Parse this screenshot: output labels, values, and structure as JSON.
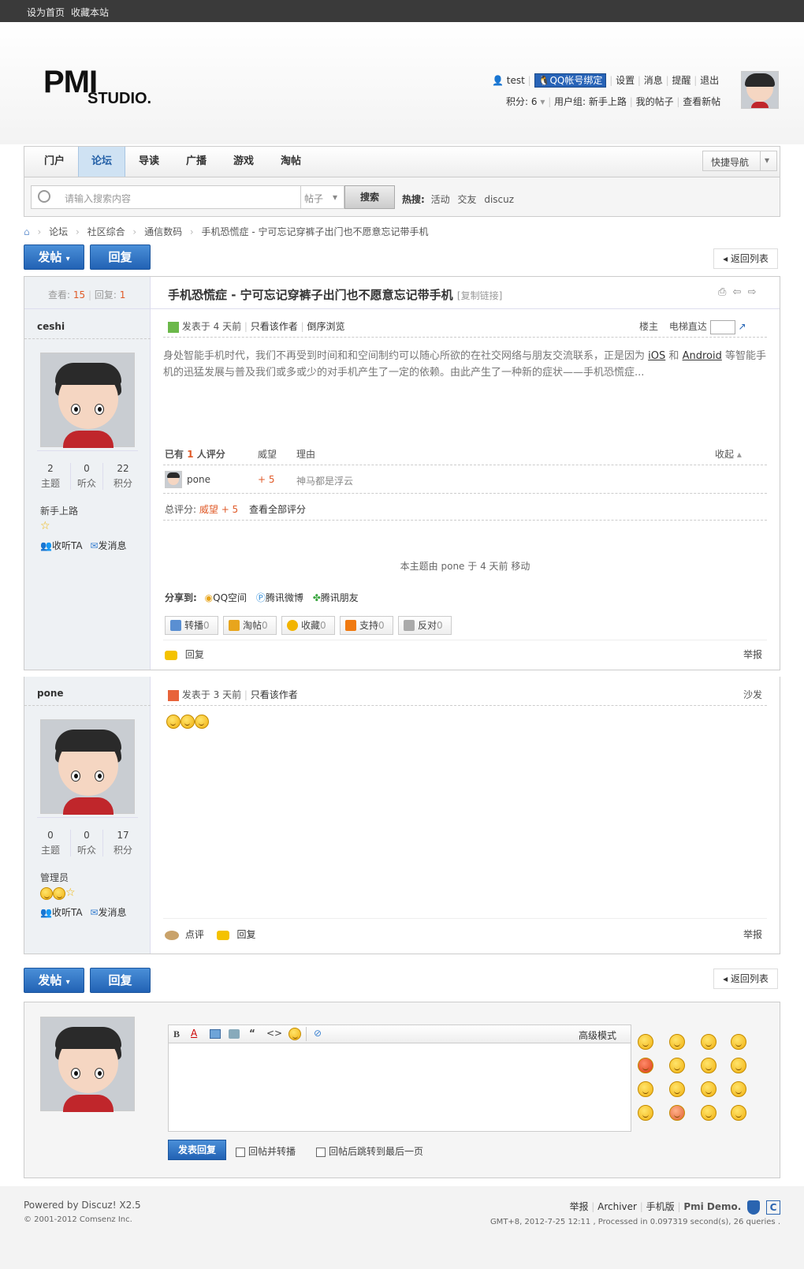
{
  "topbar": {
    "set_home": "设为首页",
    "bookmark": "收藏本站"
  },
  "logo": {
    "line1": "PMI",
    "line2": "STUDIO."
  },
  "user": {
    "name": "test",
    "qq_bind": "QQ帐号绑定",
    "settings": "设置",
    "messages": "消息",
    "reminders": "提醒",
    "logout": "退出",
    "points": "积分: 6",
    "usergroup": "用户组: 新手上路",
    "my_posts": "我的帖子",
    "new_posts": "查看新帖"
  },
  "nav": {
    "items": [
      "门户",
      "论坛",
      "导读",
      "广播",
      "游戏",
      "淘帖"
    ],
    "quick_nav": "快捷导航"
  },
  "search": {
    "placeholder": "请输入搜索内容",
    "type": "帖子",
    "button": "搜索",
    "hot_label": "热搜:",
    "hot": [
      "活动",
      "交友",
      "discuz"
    ]
  },
  "breadcrumb": [
    "论坛",
    "社区综合",
    "通信数码",
    "手机恐慌症 - 宁可忘记穿裤子出门也不愿意忘记带手机"
  ],
  "actions": {
    "new_post": "发帖",
    "reply": "回复",
    "back_to_list": "返回列表"
  },
  "thread": {
    "views_label": "查看:",
    "views": "15",
    "replies_label": "回复:",
    "replies": "1",
    "title": "手机恐慌症 - 宁可忘记穿裤子出门也不愿意忘记带手机",
    "copy_link": "[复制链接]"
  },
  "post1": {
    "author": "ceshi",
    "stats": [
      {
        "n": "2",
        "t": "主题"
      },
      {
        "n": "0",
        "t": "听众"
      },
      {
        "n": "22",
        "t": "积分"
      }
    ],
    "group": "新手上路",
    "follow": "收听TA",
    "send_msg": "发消息",
    "posted": "发表于 4 天前",
    "only_author": "只看该作者",
    "reverse": "倒序浏览",
    "floor": "楼主",
    "jump_label": "电梯直达",
    "content_1": "身处智能手机时代，我们不再受到时间和和空间制约可以随心所欲的在社交网络与朋友交流联系，正是因为",
    "link_ios": "iOS",
    "and": "和",
    "link_android": "Android",
    "content_2": "等智能手机的迅猛发展与普及我们或多或少的对手机产生了一定的依赖。由此产生了一种新的症状——手机恐慌症...",
    "rate_header": "已有",
    "rate_count": "1",
    "rate_header2": "人评分",
    "rate_col1": "威望",
    "rate_col2": "理由",
    "collapse": "收起",
    "rate_user": "pone",
    "rate_value": "+ 5",
    "rate_reason": "神马都是浮云",
    "total_label": "总评分:",
    "total_value": "威望 + 5",
    "view_all": "查看全部评分",
    "moved_notice": "本主题由 pone 于 4 天前 移动",
    "share_label": "分享到:",
    "share": [
      "QQ空间",
      "腾讯微博",
      "腾讯朋友"
    ],
    "buttons": [
      "转播",
      "淘帖",
      "收藏",
      "支持",
      "反对"
    ],
    "button_counts": [
      "0",
      "0",
      "0",
      "0",
      "0"
    ],
    "reply": "回复",
    "report": "举报"
  },
  "post2": {
    "author": "pone",
    "stats": [
      {
        "n": "0",
        "t": "主题"
      },
      {
        "n": "0",
        "t": "听众"
      },
      {
        "n": "17",
        "t": "积分"
      }
    ],
    "group": "管理员",
    "follow": "收听TA",
    "send_msg": "发消息",
    "posted": "发表于 3 天前",
    "only_author": "只看该作者",
    "floor": "沙发",
    "comment": "点评",
    "reply": "回复",
    "report": "举报"
  },
  "editor": {
    "advanced": "高级模式",
    "submit": "发表回复",
    "opt1": "回帖并转播",
    "opt2": "回帖后跳转到最后一页"
  },
  "footer": {
    "powered": "Powered by",
    "discuz": "Discuz!",
    "version": "X2.5",
    "copyright": "© 2001-2012 Comsenz Inc.",
    "links": [
      "举报",
      "Archiver",
      "手机版"
    ],
    "site": "Pmi Demo.",
    "gmt": "GMT+8, 2012-7-25 12:11 , Processed in 0.097319 second(s), 26 queries ."
  },
  "colors": {
    "accent": "#2262b4",
    "highlight": "#e05a28",
    "nav_active": "#cfe2f3"
  }
}
